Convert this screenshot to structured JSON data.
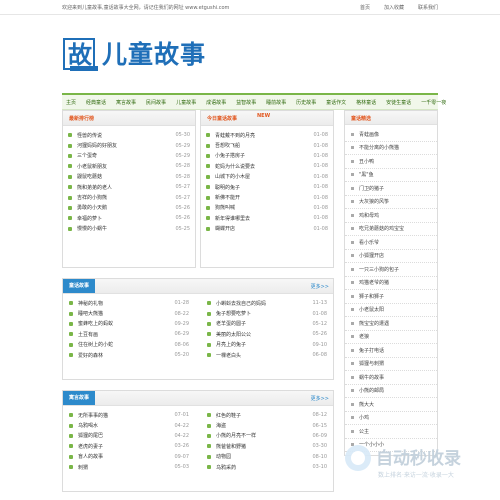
{
  "topbar": {
    "welcome": "欢迎来到儿童故事,童话故事大全网，请记住我们的网址 www.etgushi.com",
    "links": [
      "首页",
      "加入收藏",
      "联系我们"
    ]
  },
  "logo": {
    "char": "故",
    "text": "儿童故事"
  },
  "nav": [
    "主页",
    "经典童话",
    "寓言故事",
    "民间故事",
    "儿童故事",
    "成语故事",
    "益智故事",
    "睡前故事",
    "历史故事",
    "童话作文",
    "格林童话",
    "安徒生童话",
    "一千零一夜"
  ],
  "panels": {
    "latest": {
      "title": "最新排行榜",
      "items": [
        {
          "t": "怪兽的传说",
          "d": "05-30"
        },
        {
          "t": "河狸妈妈的好朋友",
          "d": "05-29"
        },
        {
          "t": "三个蛋奇",
          "d": "05-29"
        },
        {
          "t": "小老鼠新朋友",
          "d": "05-28"
        },
        {
          "t": "鼹鼠吃蘑菇",
          "d": "05-28"
        },
        {
          "t": "熊和弟弟的老人",
          "d": "05-27"
        },
        {
          "t": "吉祥的小狗熊",
          "d": "05-27"
        },
        {
          "t": "勇敢的小天鹅",
          "d": "05-26"
        },
        {
          "t": "幸福的萝卜",
          "d": "05-26"
        },
        {
          "t": "慢慢的小蜗牛",
          "d": "05-25"
        }
      ]
    },
    "today": {
      "title": "今日童话故事",
      "badge": "NEW",
      "items": [
        {
          "t": "青蛙戴不到的月亮",
          "d": "01-08"
        },
        {
          "t": "吾想吹飞船",
          "d": "01-08"
        },
        {
          "t": "小兔子搭房子",
          "d": "01-08"
        },
        {
          "t": "蛇妈为什么说要去",
          "d": "01-08"
        },
        {
          "t": "山城下的小木屋",
          "d": "01-08"
        },
        {
          "t": "聪明的兔子",
          "d": "01-08"
        },
        {
          "t": "新佛不能开",
          "d": "01-08"
        },
        {
          "t": "狗熊叫喊",
          "d": "01-08"
        },
        {
          "t": "新年得谁哪里去",
          "d": "01-08"
        },
        {
          "t": "蝴蝶开店",
          "d": "01-08"
        }
      ]
    }
  },
  "blocks": [
    {
      "title": "童话故事",
      "more": "更多>>",
      "left": [
        {
          "t": "神秘的礼物",
          "d": "01-28"
        },
        {
          "t": "睡吧大熊猫",
          "d": "08-22"
        },
        {
          "t": "蜜蜂吃上的蚂蚁",
          "d": "09-29"
        },
        {
          "t": "土豆有画",
          "d": "06-29"
        },
        {
          "t": "住在树上的小蛇",
          "d": "08-06"
        },
        {
          "t": "爱好的森林",
          "d": "05-20"
        }
      ],
      "right": [
        {
          "t": "小蝌蚪去找自己的妈妈",
          "d": "11-13"
        },
        {
          "t": "兔子想要吃萝卜",
          "d": "01-08"
        },
        {
          "t": "老羊蛋的圆子",
          "d": "05-12"
        },
        {
          "t": "美丽的太阳公公",
          "d": "05-26"
        },
        {
          "t": "月亮上的兔子",
          "d": "09-10"
        },
        {
          "t": "一棵老白头",
          "d": "06-08"
        }
      ]
    },
    {
      "title": "寓言故事",
      "more": "更多>>",
      "left": [
        {
          "t": "无所事事的猫",
          "d": "07-01"
        },
        {
          "t": "乌鸦喝水",
          "d": "04-22"
        },
        {
          "t": "狐狸的尾巴",
          "d": "04-22"
        },
        {
          "t": "老虎的妻子",
          "d": "03-26"
        },
        {
          "t": "盲人的故事",
          "d": "09-07"
        },
        {
          "t": "刺猬",
          "d": "05-03"
        }
      ],
      "right": [
        {
          "t": "红色的鞋子",
          "d": "08-12"
        },
        {
          "t": "海盗",
          "d": "06-15"
        },
        {
          "t": "小熊的月亮不一样",
          "d": "06-09"
        },
        {
          "t": "熊爸爸和野猪",
          "d": "03-30"
        },
        {
          "t": "动物园",
          "d": "08-10"
        },
        {
          "t": "乌鸦采药",
          "d": "03-10"
        }
      ]
    }
  ],
  "sidebar": {
    "title": "童话精选",
    "items": [
      "青蛙画像",
      "不能分离的小熊猫",
      "丑小鸭",
      "\"黑\"鱼",
      "门卫的猪子",
      "大灰狼的风筝",
      "鸡和母鸡",
      "吃兄弟蘑菇的鸡宝宝",
      "看小乐爷",
      "小狐狸开店",
      "一只三小狗的包子",
      "鸡猫老爷的猪",
      "狮子和狮子",
      "小老鼠太阳",
      "熊宝宝的遭遇",
      "老狼",
      "兔子打电话",
      "狐狸与刺猬",
      "蜗牛的故事",
      "小熊的邮局",
      "熊大大",
      "小鸡",
      "公主",
      "一个小小小"
    ]
  },
  "watermark": {
    "title": "自动秒收录",
    "sub": "数上排名·来访一流·收录一大"
  }
}
